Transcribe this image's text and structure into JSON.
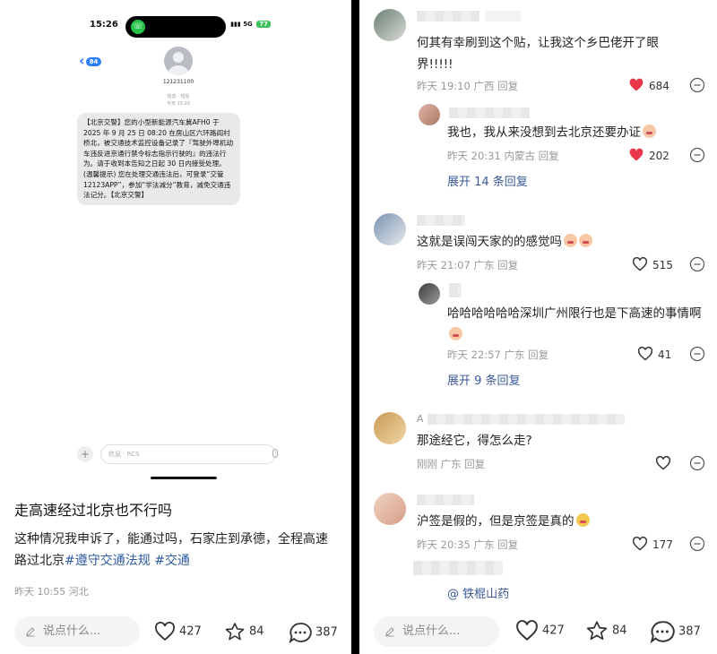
{
  "left": {
    "phone": {
      "time": "15:26",
      "signal": "5G",
      "battery": "77",
      "back_count": "84",
      "contact_number": "121231100",
      "meta_line1": "信息 · 短信",
      "meta_line2": "今天 15:20",
      "sms_text": "【北京交警】您的小型新能源汽车冀AFH0  于 2025 年 9 月 25 日 08:20 在房山区六环路阎村桥北，被交通技术监控设备记录了『驾驶外埠机动车违反进京通行禁令标志指示行驶的』的违法行为。请于收到本告知之日起 30 日内接受处理。(温馨提示) 您在处理交通违法后，可登录“交管12123APP”，参加“学法减分”教育，减免交通违法记分。【北京交警】",
      "compose_placeholder": "信息 · RCS"
    },
    "post": {
      "title": "走高速经过北京也不行吗",
      "body": "这种情况我申诉了，能通过吗，石家庄到承德，全程高速路过北京",
      "tag1": "#遵守交通法规",
      "tag2": "#交通",
      "meta": "昨天 10:55 河北"
    },
    "bottom": {
      "say_placeholder": "说点什么...",
      "likes": "427",
      "stars": "84",
      "comments": "387"
    }
  },
  "right": {
    "comments": [
      {
        "text": "何其有幸刷到这个贴，让我这个乡巴佬开了眼界!!!!!",
        "meta": "昨天 19:10 广西 回复",
        "likes": "684",
        "liked": true
      },
      {
        "text": "我也，我从来没想到去北京还要办证",
        "meta": "昨天 20:31 内蒙古 回复",
        "likes": "202",
        "liked": true,
        "expand": "展开 14 条回复"
      },
      {
        "text": "这就是误闯天家的的感觉吗",
        "meta": "昨天 21:07 广东 回复",
        "likes": "515",
        "liked": false
      },
      {
        "text": "哈哈哈哈哈哈深圳广州限行也是下高速的事情啊",
        "meta": "昨天 22:57 广东 回复",
        "likes": "41",
        "liked": false,
        "expand": "展开 9 条回复"
      },
      {
        "name_initial": "A",
        "text": "那途经它，得怎么走?",
        "meta": "刚刚 广东 回复",
        "likes": "",
        "liked": false
      },
      {
        "text": "沪签是假的，但是京签是真的",
        "meta": "昨天 20:35 广东 回复",
        "likes": "177",
        "liked": false
      }
    ],
    "mention": "@ 铁棍山药",
    "bottom": {
      "say_placeholder": "说点什么...",
      "likes": "427",
      "stars": "84",
      "comments": "387"
    }
  },
  "colors": {
    "heart_red": "#e8374a",
    "tag_blue": "#2f5b9e",
    "link_blue": "#3b5998",
    "ios_blue": "#2a7df5"
  }
}
